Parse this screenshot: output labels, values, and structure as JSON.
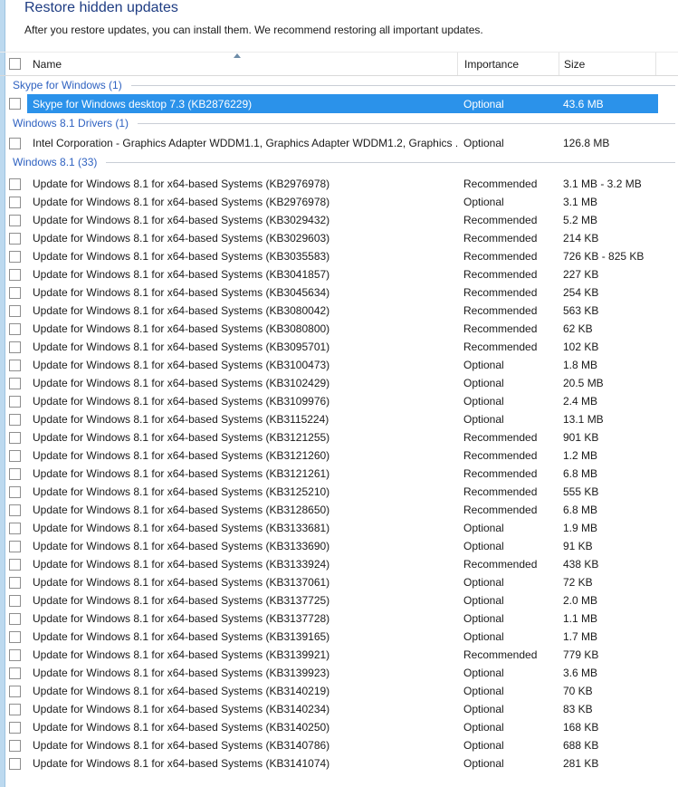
{
  "page": {
    "title": "Restore hidden updates",
    "subtitle": "After you restore updates, you can install them. We recommend restoring all important updates."
  },
  "table": {
    "columns": [
      "Name",
      "Importance",
      "Size"
    ],
    "sort": {
      "column": "Name",
      "direction": "ascending"
    },
    "groups": [
      {
        "label": "Skype for Windows (1)",
        "rows": [
          {
            "name": "Skype for Windows desktop 7.3 (KB2876229)",
            "importance": "Optional",
            "size": "43.6 MB",
            "selected": true
          }
        ]
      },
      {
        "label": "Windows 8.1 Drivers (1)",
        "rows": [
          {
            "name": "Intel Corporation - Graphics Adapter WDDM1.1, Graphics Adapter WDDM1.2, Graphics ...",
            "importance": "Optional",
            "size": "126.8 MB",
            "selected": false
          }
        ]
      },
      {
        "label": "Windows 8.1 (33)",
        "rows": [
          {
            "name": "Update for Windows 8.1 for x64-based Systems (KB2976978)",
            "importance": "Recommended",
            "size": "3.1 MB - 3.2 MB",
            "selected": false
          },
          {
            "name": "Update for Windows 8.1 for x64-based Systems (KB2976978)",
            "importance": "Optional",
            "size": "3.1 MB",
            "selected": false
          },
          {
            "name": "Update for Windows 8.1 for x64-based Systems (KB3029432)",
            "importance": "Recommended",
            "size": "5.2 MB",
            "selected": false
          },
          {
            "name": "Update for Windows 8.1 for x64-based Systems (KB3029603)",
            "importance": "Recommended",
            "size": "214 KB",
            "selected": false
          },
          {
            "name": "Update for Windows 8.1 for x64-based Systems (KB3035583)",
            "importance": "Recommended",
            "size": "726 KB - 825 KB",
            "selected": false
          },
          {
            "name": "Update for Windows 8.1 for x64-based Systems (KB3041857)",
            "importance": "Recommended",
            "size": "227 KB",
            "selected": false
          },
          {
            "name": "Update for Windows 8.1 for x64-based Systems (KB3045634)",
            "importance": "Recommended",
            "size": "254 KB",
            "selected": false
          },
          {
            "name": "Update for Windows 8.1 for x64-based Systems (KB3080042)",
            "importance": "Recommended",
            "size": "563 KB",
            "selected": false
          },
          {
            "name": "Update for Windows 8.1 for x64-based Systems (KB3080800)",
            "importance": "Recommended",
            "size": "62 KB",
            "selected": false
          },
          {
            "name": "Update for Windows 8.1 for x64-based Systems (KB3095701)",
            "importance": "Recommended",
            "size": "102 KB",
            "selected": false
          },
          {
            "name": "Update for Windows 8.1 for x64-based Systems (KB3100473)",
            "importance": "Optional",
            "size": "1.8 MB",
            "selected": false
          },
          {
            "name": "Update for Windows 8.1 for x64-based Systems (KB3102429)",
            "importance": "Optional",
            "size": "20.5 MB",
            "selected": false
          },
          {
            "name": "Update for Windows 8.1 for x64-based Systems (KB3109976)",
            "importance": "Optional",
            "size": "2.4 MB",
            "selected": false
          },
          {
            "name": "Update for Windows 8.1 for x64-based Systems (KB3115224)",
            "importance": "Optional",
            "size": "13.1 MB",
            "selected": false
          },
          {
            "name": "Update for Windows 8.1 for x64-based Systems (KB3121255)",
            "importance": "Recommended",
            "size": "901 KB",
            "selected": false
          },
          {
            "name": "Update for Windows 8.1 for x64-based Systems (KB3121260)",
            "importance": "Recommended",
            "size": "1.2 MB",
            "selected": false
          },
          {
            "name": "Update for Windows 8.1 for x64-based Systems (KB3121261)",
            "importance": "Recommended",
            "size": "6.8 MB",
            "selected": false
          },
          {
            "name": "Update for Windows 8.1 for x64-based Systems (KB3125210)",
            "importance": "Recommended",
            "size": "555 KB",
            "selected": false
          },
          {
            "name": "Update for Windows 8.1 for x64-based Systems (KB3128650)",
            "importance": "Recommended",
            "size": "6.8 MB",
            "selected": false
          },
          {
            "name": "Update for Windows 8.1 for x64-based Systems (KB3133681)",
            "importance": "Optional",
            "size": "1.9 MB",
            "selected": false
          },
          {
            "name": "Update for Windows 8.1 for x64-based Systems (KB3133690)",
            "importance": "Optional",
            "size": "91 KB",
            "selected": false
          },
          {
            "name": "Update for Windows 8.1 for x64-based Systems (KB3133924)",
            "importance": "Recommended",
            "size": "438 KB",
            "selected": false
          },
          {
            "name": "Update for Windows 8.1 for x64-based Systems (KB3137061)",
            "importance": "Optional",
            "size": "72 KB",
            "selected": false
          },
          {
            "name": "Update for Windows 8.1 for x64-based Systems (KB3137725)",
            "importance": "Optional",
            "size": "2.0 MB",
            "selected": false
          },
          {
            "name": "Update for Windows 8.1 for x64-based Systems (KB3137728)",
            "importance": "Optional",
            "size": "1.1 MB",
            "selected": false
          },
          {
            "name": "Update for Windows 8.1 for x64-based Systems (KB3139165)",
            "importance": "Optional",
            "size": "1.7 MB",
            "selected": false
          },
          {
            "name": "Update for Windows 8.1 for x64-based Systems (KB3139921)",
            "importance": "Recommended",
            "size": "779 KB",
            "selected": false
          },
          {
            "name": "Update for Windows 8.1 for x64-based Systems (KB3139923)",
            "importance": "Optional",
            "size": "3.6 MB",
            "selected": false
          },
          {
            "name": "Update for Windows 8.1 for x64-based Systems (KB3140219)",
            "importance": "Optional",
            "size": "70 KB",
            "selected": false
          },
          {
            "name": "Update for Windows 8.1 for x64-based Systems (KB3140234)",
            "importance": "Optional",
            "size": "83 KB",
            "selected": false
          },
          {
            "name": "Update for Windows 8.1 for x64-based Systems (KB3140250)",
            "importance": "Optional",
            "size": "168 KB",
            "selected": false
          },
          {
            "name": "Update for Windows 8.1 for x64-based Systems (KB3140786)",
            "importance": "Optional",
            "size": "688 KB",
            "selected": false
          },
          {
            "name": "Update for Windows 8.1 for x64-based Systems (KB3141074)",
            "importance": "Optional",
            "size": "281 KB",
            "selected": false
          }
        ]
      }
    ]
  },
  "colors": {
    "title_text": "#1e3c82",
    "group_label": "#2f62c1",
    "selection_bg": "#2b92ea",
    "selection_text": "#ffffff",
    "left_strip": "#bcd9ef",
    "row_text": "#1a1a1a"
  }
}
